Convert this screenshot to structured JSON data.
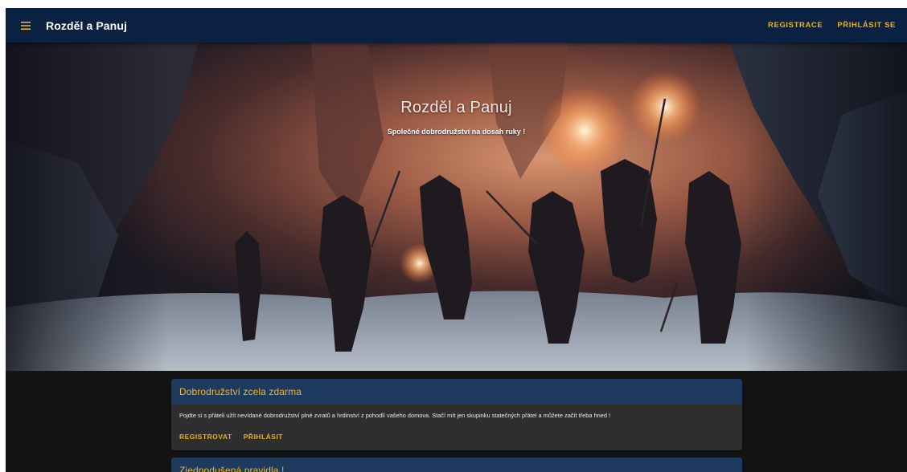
{
  "appbar": {
    "title": "Rozděl a Panuj",
    "menu_icon": "menu-icon",
    "links": {
      "register": "REGISTRACE",
      "login": "PŘIHLÁSIT SE"
    }
  },
  "hero": {
    "title": "Rozděl a Panuj",
    "subtitle": "Společné dobrodružství na dosah ruky !"
  },
  "cards": [
    {
      "title": "Dobrodružství zcela zdarma",
      "body": "Pojdte si s přáteli užít nevídané dobrodružství plné zvratů a hrdinství z pohodlí vašeho domova. Stačí mít jen skupinku statečných přátel a můžete začít třeba hned !",
      "actions": {
        "register": "REGISTROVAT",
        "login": "PŘIHLÁSIT"
      }
    },
    {
      "title": "Zjednodušená pravidla !"
    }
  ],
  "colors": {
    "appbar": "#0b2142",
    "accent": "#e8b21b",
    "card_header": "#1e3a5f",
    "card_body": "#2e2e2e",
    "page_background": "#141414"
  }
}
